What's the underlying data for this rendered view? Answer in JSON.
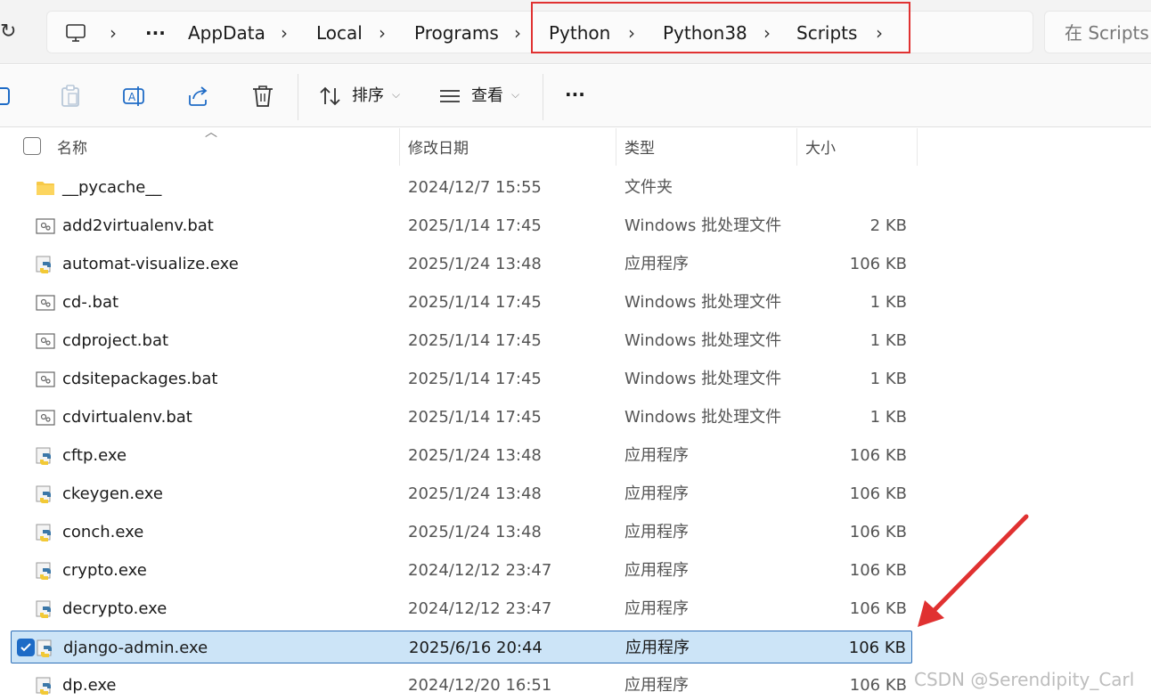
{
  "address_bar": {
    "refresh_icon": "refresh-icon",
    "computer_icon": "computer-icon",
    "overflow": "···",
    "crumbs": [
      "AppData",
      "Local",
      "Programs",
      "Python",
      "Python38",
      "Scripts"
    ],
    "separator": "›"
  },
  "search": {
    "placeholder": "在 Scripts 中"
  },
  "toolbar": {
    "sort_label": "排序",
    "view_label": "查看",
    "more_label": "···",
    "icons": [
      "copy-icon",
      "paste-icon",
      "rename-icon",
      "share-icon",
      "delete-icon",
      "sort-icon",
      "view-icon"
    ]
  },
  "columns": {
    "name": "名称",
    "date": "修改日期",
    "type": "类型",
    "size": "大小"
  },
  "files": [
    {
      "name": "__pycache__",
      "date": "2024/12/7 15:55",
      "type": "文件夹",
      "size": "",
      "icon": "folder-icon"
    },
    {
      "name": "add2virtualenv.bat",
      "date": "2025/1/14 17:45",
      "type": "Windows 批处理文件",
      "size": "2 KB",
      "icon": "batch-file-icon"
    },
    {
      "name": "automat-visualize.exe",
      "date": "2025/1/24 13:48",
      "type": "应用程序",
      "size": "106 KB",
      "icon": "python-exe-icon"
    },
    {
      "name": "cd-.bat",
      "date": "2025/1/14 17:45",
      "type": "Windows 批处理文件",
      "size": "1 KB",
      "icon": "batch-file-icon"
    },
    {
      "name": "cdproject.bat",
      "date": "2025/1/14 17:45",
      "type": "Windows 批处理文件",
      "size": "1 KB",
      "icon": "batch-file-icon"
    },
    {
      "name": "cdsitepackages.bat",
      "date": "2025/1/14 17:45",
      "type": "Windows 批处理文件",
      "size": "1 KB",
      "icon": "batch-file-icon"
    },
    {
      "name": "cdvirtualenv.bat",
      "date": "2025/1/14 17:45",
      "type": "Windows 批处理文件",
      "size": "1 KB",
      "icon": "batch-file-icon"
    },
    {
      "name": "cftp.exe",
      "date": "2025/1/24 13:48",
      "type": "应用程序",
      "size": "106 KB",
      "icon": "python-exe-icon"
    },
    {
      "name": "ckeygen.exe",
      "date": "2025/1/24 13:48",
      "type": "应用程序",
      "size": "106 KB",
      "icon": "python-exe-icon"
    },
    {
      "name": "conch.exe",
      "date": "2025/1/24 13:48",
      "type": "应用程序",
      "size": "106 KB",
      "icon": "python-exe-icon"
    },
    {
      "name": "crypto.exe",
      "date": "2024/12/12 23:47",
      "type": "应用程序",
      "size": "106 KB",
      "icon": "python-exe-icon"
    },
    {
      "name": "decrypto.exe",
      "date": "2024/12/12 23:47",
      "type": "应用程序",
      "size": "106 KB",
      "icon": "python-exe-icon"
    },
    {
      "name": "django-admin.exe",
      "date": "2025/6/16 20:44",
      "type": "应用程序",
      "size": "106 KB",
      "icon": "python-exe-icon",
      "selected": true
    },
    {
      "name": "dp.exe",
      "date": "2024/12/20 16:51",
      "type": "应用程序",
      "size": "106 KB",
      "icon": "python-exe-icon"
    }
  ],
  "watermark": "CSDN @Serendipity_Carl",
  "colors": {
    "selection_bg": "#cce4f7",
    "selection_border": "#2d6fb8",
    "highlight_box": "#e03131",
    "arrow": "#e03131"
  }
}
